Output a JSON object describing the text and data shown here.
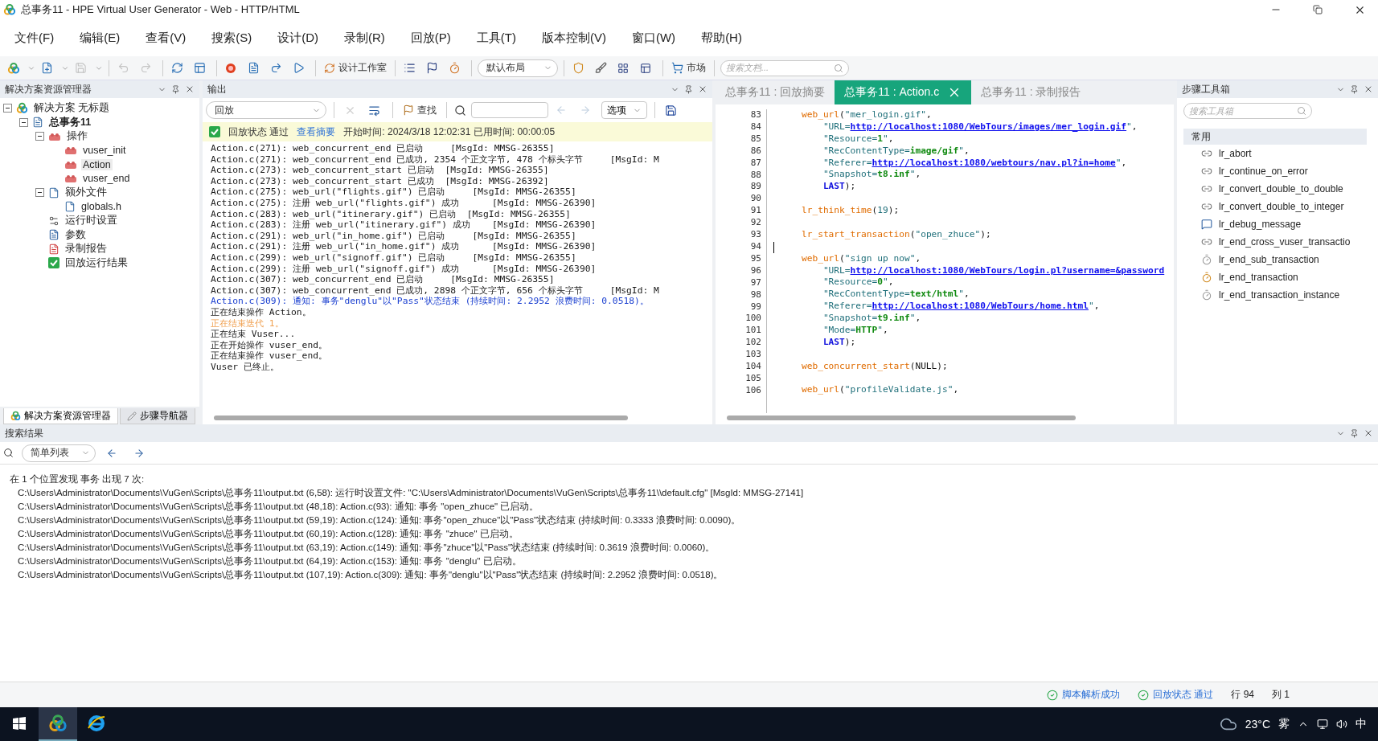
{
  "window": {
    "title": "总事务11 - HPE Virtual User Generator - Web - HTTP/HTML"
  },
  "menu": [
    "文件(F)",
    "编辑(E)",
    "查看(V)",
    "搜索(S)",
    "设计(D)",
    "录制(R)",
    "回放(P)",
    "工具(T)",
    "版本控制(V)",
    "窗口(W)",
    "帮助(H)"
  ],
  "toolbar": {
    "icon_buttons": [
      {
        "disabled": false
      },
      {
        "disabled": false
      },
      {
        "disabled": true
      },
      {
        "disabled": true
      },
      {
        "disabled": true
      },
      {
        "disabled": false
      },
      {
        "disabled": false
      },
      {
        "disabled": false
      },
      {
        "disabled": false
      },
      {
        "disabled": false
      },
      {
        "disabled": false
      }
    ],
    "design_studio": "设计工作室",
    "layout": "默认布局",
    "market": "市场",
    "search_placeholder": "搜索文档..."
  },
  "solution_explorer": {
    "title": "解决方案资源管理器",
    "tree": [
      {
        "label": "解决方案 无标题",
        "kind": "solution",
        "expanded": true,
        "children": [
          {
            "label": "总事务11",
            "kind": "script",
            "bold": true,
            "expanded": true,
            "children": [
              {
                "label": "操作",
                "kind": "actions",
                "expanded": true,
                "children": [
                  {
                    "label": "vuser_init",
                    "kind": "action",
                    "selected": false
                  },
                  {
                    "label": "Action",
                    "kind": "action",
                    "selected": true
                  },
                  {
                    "label": "vuser_end",
                    "kind": "action",
                    "selected": false
                  }
                ]
              },
              {
                "label": "额外文件",
                "kind": "folder",
                "expanded": true,
                "children": [
                  {
                    "label": "globals.h",
                    "kind": "file",
                    "selected": false
                  }
                ]
              },
              {
                "label": "运行时设置",
                "kind": "settings",
                "selected": false
              },
              {
                "label": "参数",
                "kind": "params",
                "selected": false
              },
              {
                "label": "录制报告",
                "kind": "report",
                "selected": false
              },
              {
                "label": "回放运行结果",
                "kind": "result",
                "selected": false
              }
            ]
          }
        ]
      }
    ],
    "tabs": [
      {
        "label": "解决方案资源管理器",
        "selected": true
      },
      {
        "label": "步骤导航器",
        "selected": false
      }
    ]
  },
  "output": {
    "title": "输出",
    "source": "回放",
    "find": "查找",
    "options": "选项",
    "status": {
      "label": "回放状态 通过",
      "link": "查看摘要",
      "info": "开始时间: 2024/3/18 12:02:31 已用时间: 00:00:05"
    },
    "lines": [
      {
        "kind": "plain",
        "text": "Action.c(271): web_concurrent_end 已启动     [MsgId: MMSG-26355]"
      },
      {
        "kind": "plain",
        "text": "Action.c(271): web_concurrent_end 已成功, 2354 个正文字节, 478 个标头字节     [MsgId: M"
      },
      {
        "kind": "plain",
        "text": "Action.c(273): web_concurrent_start 已启动  [MsgId: MMSG-26355]"
      },
      {
        "kind": "plain",
        "text": "Action.c(273): web_concurrent_start 已成功  [MsgId: MMSG-26392]"
      },
      {
        "kind": "plain",
        "text": "Action.c(275): web_url(\"flights.gif\") 已启动     [MsgId: MMSG-26355]"
      },
      {
        "kind": "plain",
        "text": "Action.c(275): 注册 web_url(\"flights.gif\") 成功      [MsgId: MMSG-26390]"
      },
      {
        "kind": "plain",
        "text": "Action.c(283): web_url(\"itinerary.gif\") 已启动  [MsgId: MMSG-26355]"
      },
      {
        "kind": "plain",
        "text": "Action.c(283): 注册 web_url(\"itinerary.gif\") 成功    [MsgId: MMSG-26390]"
      },
      {
        "kind": "plain",
        "text": "Action.c(291): web_url(\"in_home.gif\") 已启动     [MsgId: MMSG-26355]"
      },
      {
        "kind": "plain",
        "text": "Action.c(291): 注册 web_url(\"in_home.gif\") 成功      [MsgId: MMSG-26390]"
      },
      {
        "kind": "plain",
        "text": "Action.c(299): web_url(\"signoff.gif\") 已启动     [MsgId: MMSG-26355]"
      },
      {
        "kind": "plain",
        "text": "Action.c(299): 注册 web_url(\"signoff.gif\") 成功      [MsgId: MMSG-26390]"
      },
      {
        "kind": "plain",
        "text": "Action.c(307): web_concurrent_end 已启动     [MsgId: MMSG-26355]"
      },
      {
        "kind": "plain",
        "text": "Action.c(307): web_concurrent_end 已成功, 2898 个正文字节, 656 个标头字节     [MsgId: M"
      },
      {
        "kind": "notice",
        "text": "Action.c(309): 通知: 事务\"denglu\"以\"Pass\"状态结束 (持续时间: 2.2952 浪费时间: 0.0518)。"
      },
      {
        "kind": "plain",
        "text": "正在结束操作 Action。"
      },
      {
        "kind": "warn",
        "text": "正在结束迭代 1。"
      },
      {
        "kind": "plain",
        "text": "正在结束 Vuser..."
      },
      {
        "kind": "plain",
        "text": "正在开始操作 vuser_end。"
      },
      {
        "kind": "plain",
        "text": "正在结束操作 vuser_end。"
      },
      {
        "kind": "plain",
        "text": "Vuser 已终止。"
      }
    ]
  },
  "editor": {
    "tabs": [
      {
        "label": "总事务11 : 回放摘要",
        "selected": false
      },
      {
        "label": "总事务11 : Action.c",
        "selected": true
      },
      {
        "label": "总事务11 : 录制报告",
        "selected": false
      }
    ],
    "lines": [
      {
        "n": "83",
        "tokens": [
          {
            "kind": "fn",
            "text": "    web_url"
          },
          {
            "kind": "plain",
            "text": "("
          },
          {
            "kind": "str",
            "text": "\"mer_login.gif\""
          },
          {
            "kind": "plain",
            "text": ","
          }
        ]
      },
      {
        "n": "84",
        "tokens": [
          {
            "kind": "str",
            "text": "        \"URL="
          },
          {
            "kind": "link",
            "text": "http://localhost:1080/WebTours/images/mer_login.gif"
          },
          {
            "kind": "str",
            "text": "\""
          },
          {
            "kind": "plain",
            "text": ","
          }
        ]
      },
      {
        "n": "85",
        "tokens": [
          {
            "kind": "str",
            "text": "        \"Resource="
          },
          {
            "kind": "value",
            "text": "1"
          },
          {
            "kind": "str",
            "text": "\""
          },
          {
            "kind": "plain",
            "text": ","
          }
        ]
      },
      {
        "n": "86",
        "tokens": [
          {
            "kind": "str",
            "text": "        \"RecContentType="
          },
          {
            "kind": "value",
            "text": "image/gif"
          },
          {
            "kind": "str",
            "text": "\""
          },
          {
            "kind": "plain",
            "text": ","
          }
        ]
      },
      {
        "n": "87",
        "tokens": [
          {
            "kind": "str",
            "text": "        \"Referer="
          },
          {
            "kind": "link",
            "text": "http://localhost:1080/webtours/nav.pl?in=home"
          },
          {
            "kind": "str",
            "text": "\""
          },
          {
            "kind": "plain",
            "text": ","
          }
        ]
      },
      {
        "n": "88",
        "tokens": [
          {
            "kind": "str",
            "text": "        \"Snapshot="
          },
          {
            "kind": "value",
            "text": "t8.inf"
          },
          {
            "kind": "str",
            "text": "\""
          },
          {
            "kind": "plain",
            "text": ","
          }
        ]
      },
      {
        "n": "89",
        "tokens": [
          {
            "kind": "keyword",
            "text": "        LAST"
          },
          {
            "kind": "plain",
            "text": ");"
          }
        ]
      },
      {
        "n": "90"
      },
      {
        "n": "91",
        "tokens": [
          {
            "kind": "fn",
            "text": "    lr_think_time"
          },
          {
            "kind": "plain",
            "text": "("
          },
          {
            "kind": "number",
            "text": "19"
          },
          {
            "kind": "plain",
            "text": ");"
          }
        ]
      },
      {
        "n": "92"
      },
      {
        "n": "93",
        "tokens": [
          {
            "kind": "fn",
            "text": "    lr_start_transaction"
          },
          {
            "kind": "plain",
            "text": "("
          },
          {
            "kind": "str",
            "text": "\"open_zhuce\""
          },
          {
            "kind": "plain",
            "text": ");"
          }
        ]
      },
      {
        "n": "94",
        "cursor": true
      },
      {
        "n": "95",
        "tokens": [
          {
            "kind": "fn",
            "text": "    web_url"
          },
          {
            "kind": "plain",
            "text": "("
          },
          {
            "kind": "str",
            "text": "\"sign up now\""
          },
          {
            "kind": "plain",
            "text": ","
          }
        ]
      },
      {
        "n": "96",
        "tokens": [
          {
            "kind": "str",
            "text": "        \"URL="
          },
          {
            "kind": "link",
            "text": "http://localhost:1080/WebTours/login.pl?username=&password"
          }
        ]
      },
      {
        "n": "97",
        "tokens": [
          {
            "kind": "str",
            "text": "        \"Resource="
          },
          {
            "kind": "value",
            "text": "0"
          },
          {
            "kind": "str",
            "text": "\""
          },
          {
            "kind": "plain",
            "text": ","
          }
        ]
      },
      {
        "n": "98",
        "tokens": [
          {
            "kind": "str",
            "text": "        \"RecContentType="
          },
          {
            "kind": "value",
            "text": "text/html"
          },
          {
            "kind": "str",
            "text": "\""
          },
          {
            "kind": "plain",
            "text": ","
          }
        ]
      },
      {
        "n": "99",
        "tokens": [
          {
            "kind": "str",
            "text": "        \"Referer="
          },
          {
            "kind": "link",
            "text": "http://localhost:1080/WebTours/home.html"
          },
          {
            "kind": "str",
            "text": "\""
          },
          {
            "kind": "plain",
            "text": ","
          }
        ]
      },
      {
        "n": "100",
        "tokens": [
          {
            "kind": "str",
            "text": "        \"Snapshot="
          },
          {
            "kind": "value",
            "text": "t9.inf"
          },
          {
            "kind": "str",
            "text": "\""
          },
          {
            "kind": "plain",
            "text": ","
          }
        ]
      },
      {
        "n": "101",
        "tokens": [
          {
            "kind": "str",
            "text": "        \"Mode="
          },
          {
            "kind": "value",
            "text": "HTTP"
          },
          {
            "kind": "str",
            "text": "\""
          },
          {
            "kind": "plain",
            "text": ","
          }
        ]
      },
      {
        "n": "102",
        "tokens": [
          {
            "kind": "keyword",
            "text": "        LAST"
          },
          {
            "kind": "plain",
            "text": ");"
          }
        ]
      },
      {
        "n": "103"
      },
      {
        "n": "104",
        "tokens": [
          {
            "kind": "fn",
            "text": "    web_concurrent_start"
          },
          {
            "kind": "plain",
            "text": "(NULL);"
          }
        ]
      },
      {
        "n": "105"
      },
      {
        "n": "106",
        "tokens": [
          {
            "kind": "fn",
            "text": "    web_url"
          },
          {
            "kind": "plain",
            "text": "("
          },
          {
            "kind": "str",
            "text": "\"profileValidate.js\""
          },
          {
            "kind": "plain",
            "text": ","
          }
        ]
      }
    ]
  },
  "toolbox": {
    "title": "步骤工具箱",
    "search_placeholder": "搜索工具箱",
    "group": "常用",
    "items": [
      {
        "label": "lr_abort",
        "kind": "step"
      },
      {
        "label": "lr_continue_on_error",
        "kind": "step"
      },
      {
        "label": "lr_convert_double_to_double",
        "kind": "step"
      },
      {
        "label": "lr_convert_double_to_integer",
        "kind": "step"
      },
      {
        "label": "lr_debug_message",
        "kind": "message"
      },
      {
        "label": "lr_end_cross_vuser_transactio",
        "kind": "step"
      },
      {
        "label": "lr_end_sub_transaction",
        "kind": "timer"
      },
      {
        "label": "lr_end_transaction",
        "kind": "transaction"
      },
      {
        "label": "lr_end_transaction_instance",
        "kind": "timer"
      }
    ]
  },
  "search_results": {
    "title": "搜索结果",
    "view": "简单列表",
    "summary": "在 1 个位置发现 事务 出现 7 次:",
    "results": [
      "C:\\Users\\Administrator\\Documents\\VuGen\\Scripts\\总事务11\\output.txt (6,58):  运行时设置文件: \"C:\\Users\\Administrator\\Documents\\VuGen\\Scripts\\总事务11\\\\default.cfg\"  [MsgId: MMSG-27141]",
      "C:\\Users\\Administrator\\Documents\\VuGen\\Scripts\\总事务11\\output.txt (48,18):  Action.c(93): 通知: 事务 \"open_zhuce\" 已启动。",
      "C:\\Users\\Administrator\\Documents\\VuGen\\Scripts\\总事务11\\output.txt (59,19):  Action.c(124): 通知: 事务\"open_zhuce\"以\"Pass\"状态结束 (持续时间: 0.3333 浪费时间: 0.0090)。",
      "C:\\Users\\Administrator\\Documents\\VuGen\\Scripts\\总事务11\\output.txt (60,19):  Action.c(128): 通知: 事务 \"zhuce\" 已启动。",
      "C:\\Users\\Administrator\\Documents\\VuGen\\Scripts\\总事务11\\output.txt (63,19):  Action.c(149): 通知: 事务\"zhuce\"以\"Pass\"状态结束 (持续时间: 0.3619 浪费时间: 0.0060)。",
      "C:\\Users\\Administrator\\Documents\\VuGen\\Scripts\\总事务11\\output.txt (64,19):  Action.c(153): 通知: 事务 \"denglu\" 已启动。",
      "C:\\Users\\Administrator\\Documents\\VuGen\\Scripts\\总事务11\\output.txt (107,19):  Action.c(309): 通知: 事务\"denglu\"以\"Pass\"状态结束 (持续时间: 2.2952 浪费时间: 0.0518)。"
    ]
  },
  "status_bar": {
    "parse": "脚本解析成功",
    "replay": "回放状态 通过",
    "line": "行 94",
    "column": "列 1"
  },
  "taskbar": {
    "apps": [
      {
        "selected": true
      },
      {
        "selected": false
      }
    ],
    "temperature": "23°C",
    "weather": "雾",
    "ime": "中"
  }
}
